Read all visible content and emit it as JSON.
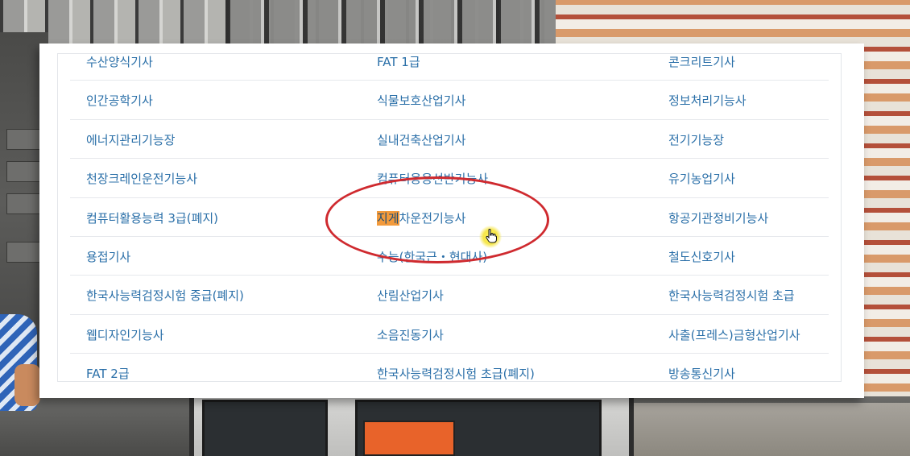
{
  "colors": {
    "link": "#2a6fa8",
    "highlight": "#f29a3c",
    "annotation_circle": "#cf2a2f",
    "cursor_glow": "#f6e64a"
  },
  "cursor": {
    "icon": "hand-pointer-icon"
  },
  "certificates": {
    "rows": [
      {
        "c0": "수산양식기사",
        "c1": "FAT 1급",
        "c2": "콘크리트기사"
      },
      {
        "c0": "인간공학기사",
        "c1": "식물보호산업기사",
        "c2": "정보처리기능사"
      },
      {
        "c0": "에너지관리기능장",
        "c1": "실내건축산업기사",
        "c2": "전기기능장"
      },
      {
        "c0": "천장크레인운전기능사",
        "c1": "컴퓨터응용선반기능사",
        "c2": "유기농업기사"
      },
      {
        "c0": "컴퓨터활용능력 3급(폐지)",
        "c1_highlight": "지게",
        "c1_rest": "차운전기능사",
        "c2": "항공기관정비기능사"
      },
      {
        "c0": "용접기사",
        "c1": "수능(한국근・현대사)",
        "c2": "철도신호기사"
      },
      {
        "c0": "한국사능력검정시험 중급(폐지)",
        "c1": "산림산업기사",
        "c2": "한국사능력검정시험 초급"
      },
      {
        "c0": "웹디자인기능사",
        "c1": "소음진동기사",
        "c2": "사출(프레스)금형산업기사"
      },
      {
        "c0": "FAT 2급",
        "c1": "한국사능력검정시험 초급(폐지)",
        "c2": "방송통신기사"
      }
    ]
  }
}
